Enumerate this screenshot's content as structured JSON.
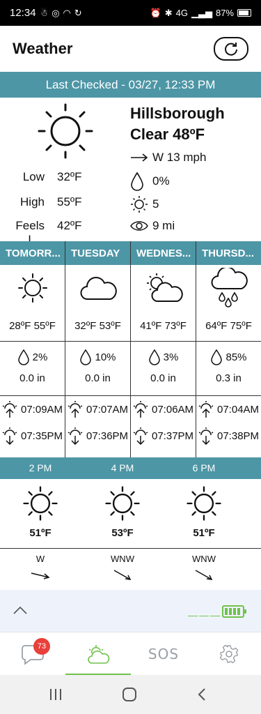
{
  "status_bar": {
    "time": "12:34",
    "battery": "87%",
    "network": "4G"
  },
  "header": {
    "title": "Weather"
  },
  "last_checked": "Last Checked - 03/27, 12:33 PM",
  "current": {
    "location": "Hillsborough",
    "condition": "Clear 48ºF",
    "wind": "W 13 mph",
    "precip": "0%",
    "uv": "5",
    "visibility": "9 mi",
    "low_label": "Low",
    "low": "32ºF",
    "high_label": "High",
    "high": "55ºF",
    "feels_label": "Feels L...",
    "feels": "42ºF"
  },
  "forecast": [
    {
      "day": "TOMORR...",
      "icon": "sun-icon",
      "temps": "28ºF 55ºF",
      "precip": "2%",
      "amount": "0.0 in",
      "sunrise": "07:09AM",
      "sunset": "07:35PM"
    },
    {
      "day": "TUESDAY",
      "icon": "cloud-icon",
      "temps": "32ºF 53ºF",
      "precip": "10%",
      "amount": "0.0 in",
      "sunrise": "07:07AM",
      "sunset": "07:36PM"
    },
    {
      "day": "WEDNES...",
      "icon": "partly-cloudy-icon",
      "temps": "41ºF 73ºF",
      "precip": "3%",
      "amount": "0.0 in",
      "sunrise": "07:06AM",
      "sunset": "07:37PM"
    },
    {
      "day": "THURSD...",
      "icon": "rain-cloud-icon",
      "temps": "64ºF 75ºF",
      "precip": "85%",
      "amount": "0.3 in",
      "sunrise": "07:04AM",
      "sunset": "07:38PM"
    }
  ],
  "hourly": [
    {
      "time": "2 PM",
      "temp": "51ºF",
      "wind_dir": "W"
    },
    {
      "time": "4 PM",
      "temp": "53ºF",
      "wind_dir": "WNW"
    },
    {
      "time": "6 PM",
      "temp": "51ºF",
      "wind_dir": "WNW"
    }
  ],
  "tabs": {
    "messages_badge": "73",
    "sos_label": "SOS"
  },
  "colors": {
    "accent": "#4d96a6",
    "green": "#6fc24a",
    "badge": "#e8403b"
  }
}
